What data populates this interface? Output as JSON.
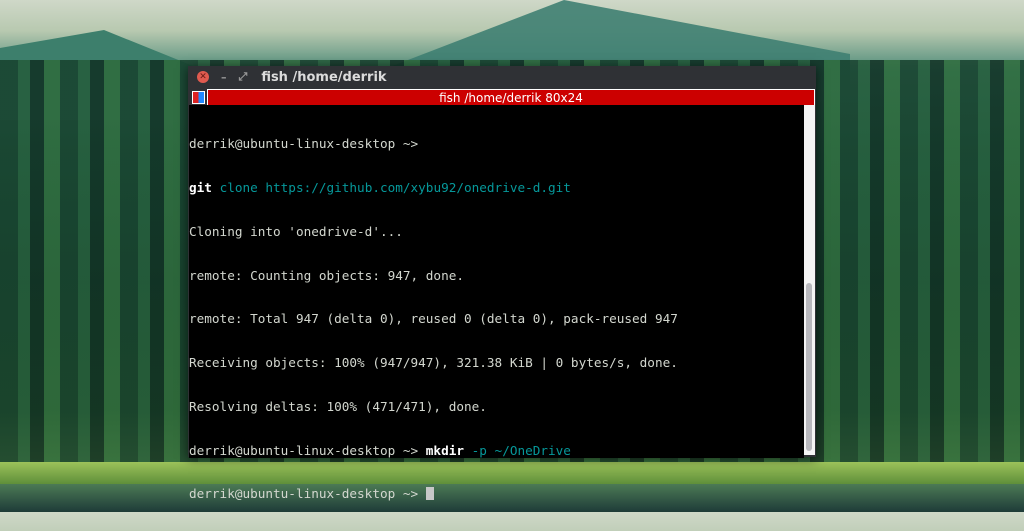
{
  "window": {
    "title": "fish  /home/derrik",
    "tab_title": "fish  /home/derrik 80x24"
  },
  "terminal": {
    "lines": [
      {
        "prompt": "derrik@ubuntu-linux-desktop ~>",
        "cmd": "",
        "args": ""
      },
      {
        "cmd": "git",
        "args": "clone https://github.com/xybu92/onedrive-d.git"
      },
      {
        "text": "Cloning into 'onedrive-d'..."
      },
      {
        "text": "remote: Counting objects: 947, done."
      },
      {
        "text": "remote: Total 947 (delta 0), reused 0 (delta 0), pack-reused 947"
      },
      {
        "text": "Receiving objects: 100% (947/947), 321.38 KiB | 0 bytes/s, done."
      },
      {
        "text": "Resolving deltas: 100% (471/471), done."
      },
      {
        "prompt": "derrik@ubuntu-linux-desktop ~>",
        "cmd": "mkdir",
        "args": "-p ~/OneDrive"
      },
      {
        "prompt": "derrik@ubuntu-linux-desktop ~>"
      }
    ],
    "scroll_position": 0.5
  }
}
